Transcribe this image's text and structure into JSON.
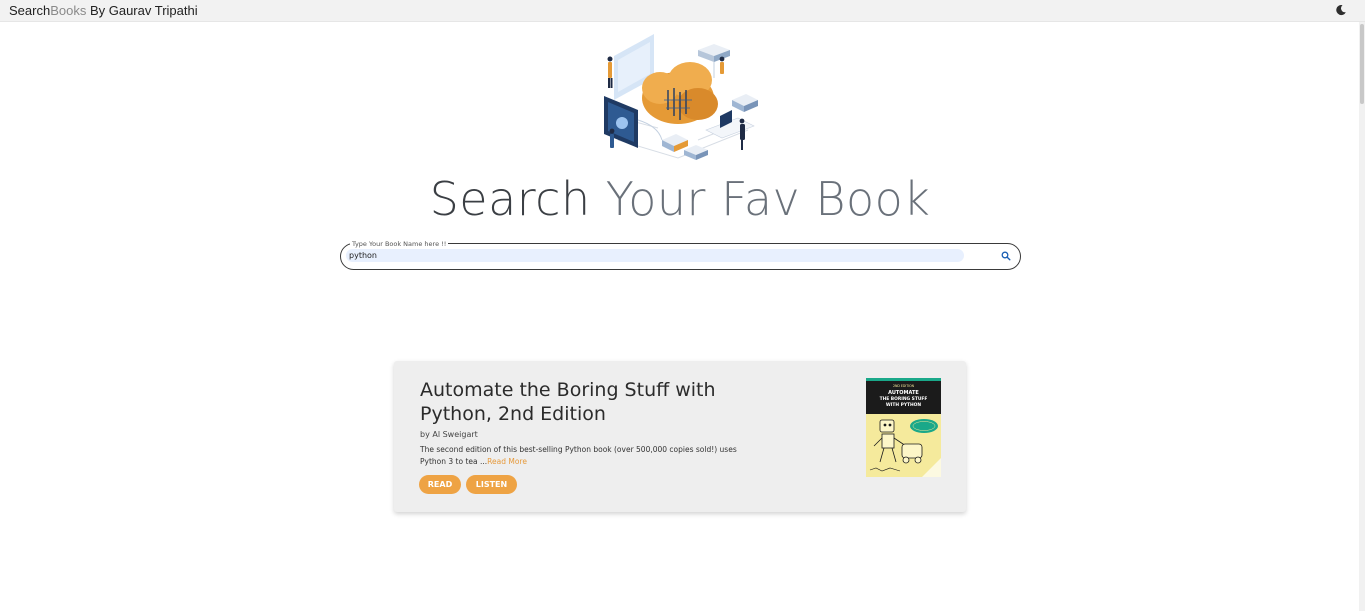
{
  "header": {
    "brand_part1": "Search",
    "brand_part2": "Books",
    "brand_part3": " By Gaurav Tripathi",
    "theme_toggle_icon": "moon-icon"
  },
  "hero": {
    "illustration": "cloud-data-illustration",
    "heading_part1": "Search",
    "heading_part2": " Your Fav Book"
  },
  "search": {
    "legend": "Type Your Book Name here !!",
    "value": "python",
    "button_icon": "search-icon"
  },
  "results": [
    {
      "title": "Automate the Boring Stuff with Python, 2nd Edition",
      "author": "by Al Sweigart",
      "description": "The second edition of this best-selling Python book (over 500,000 copies sold!) uses Python 3 to tea ...",
      "read_more": "Read More",
      "read_label": "READ",
      "listen_label": "LISTEN",
      "cover": {
        "edition_badge": "2ND EDITION",
        "title_line1": "AUTOMATE",
        "title_line2": "THE BORING STUFF",
        "title_line3": "WITH PYTHON"
      }
    }
  ],
  "colors": {
    "accent": "#eea344",
    "heading": "#3b3f44",
    "card_bg": "#eeeeee",
    "input_bg": "#e8f0fe"
  }
}
